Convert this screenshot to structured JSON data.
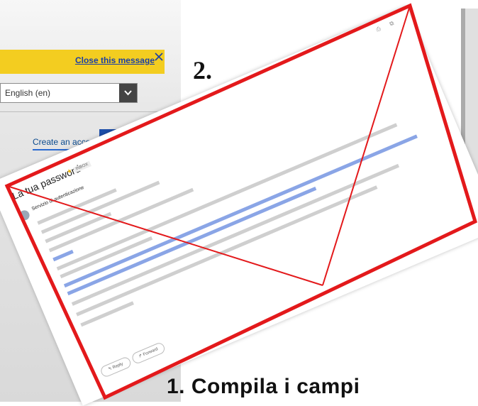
{
  "login_page": {
    "notice": {
      "close_label": "Close this message"
    },
    "language_select": {
      "value": "English (en)"
    },
    "create_account_label": "Create an account"
  },
  "annotations": {
    "step2_label": "2.",
    "step1_label": "1.  Compila i campi"
  },
  "email": {
    "subject": "La tua password",
    "tag": "INBOX",
    "sender": "Servizio di autenticazione",
    "reply_label": "Reply",
    "forward_label": "Forward"
  },
  "colors": {
    "annotation_red": "#e3191b",
    "notice_yellow": "#f3cd20",
    "link_blue": "#1a3fa6",
    "button_blue": "#1d4faa"
  }
}
